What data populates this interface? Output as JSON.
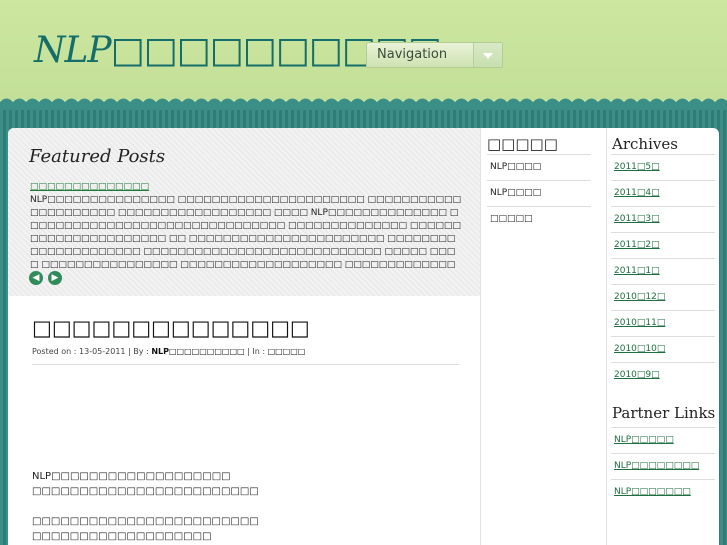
{
  "header": {
    "site_title": "NLP□□□□□□□□□□",
    "nav_label": "Navigation"
  },
  "featured": {
    "heading": "Featured Posts",
    "link_text": "□□□□□□□□□□□□□□",
    "excerpt": "NLP□□□□□□□□□□□□□□□ □□□□□□□□□□□□□□□□□□□□□□ □□□□□□□□□□□□□□□□□□□□□ □□□□□□□□□□□□□□□□□□ □□□□ NLP□□□□□□□□□□□□□□ □□□□□□□□□□□□□□□□□□□□□□□□□□□□□□□ □□□□□□□□□□□□□□ □□□□□□□□□□□□□□□□□□□□□□ □□ □□□□□□□□□□□□□□□□□□□□□□□ □□□□□□□□□□□□□□□□□□□□□ □□□□□□□□□□□□□□□□□□□□□□□□□□□□ □□□□□ □□□□ □□□□□□□□□□□□□□□□ □□□□□□□□□□□□□□□□□□□ □□□□□□□□□□□□□□□□□□□□□□□ □□□□□□□□□□□□□□□□□□□□□□□□□□□□□□ □□□ □□□□□□□□□□□□□□□□□□□□□□□□□□□□□□□ □□□□□□□□□□□□□□□□□□□□□□□□ □□□□□□□□□□□□□□□□□□□□□□□□□□□□ □□ □□□□□□□□□□NLP□□□□□□□□□□□□□□□□□□□□□ □□□□□ □□□□□□□□□□□□□□□□□□□□□□□□□□□□□□□□□□□ □□□□□□□"
  },
  "post": {
    "title": "□□□□□□□□□□□□□□",
    "meta_prefix": "Posted on : 13-05-2011 | By : ",
    "author": "NLP□□□□□□□□□□",
    "meta_in": " | In : ",
    "category": "□□□□□",
    "lines": [
      "NLP□□□□□□□□□□□□□□□□□□□",
      "□□□□□□□□□□□□□□□□□□□□□□□□",
      "□□□□□□□□□□□□□□□□□□□□□□□□",
      "□□□□□□□□□□□□□□□□□□□"
    ]
  },
  "sidebar1": {
    "title": "□□□□□",
    "items": [
      {
        "label": "NLP□□□□",
        "link": false
      },
      {
        "label": "NLP□□□□",
        "link": false
      },
      {
        "label": "□□□□□",
        "link": false
      }
    ]
  },
  "sidebar2": {
    "archives_title": "Archives",
    "archives": [
      "2011□5□",
      "2011□4□",
      "2011□3□",
      "2011□2□",
      "2011□1□",
      "2010□12□",
      "2010□11□",
      "2010□10□",
      "2010□9□"
    ],
    "partner_title": "Partner Links",
    "partners": [
      "NLP□□□□□",
      "NLP□□□□□□□□",
      "NLP□□□□□□□"
    ]
  }
}
